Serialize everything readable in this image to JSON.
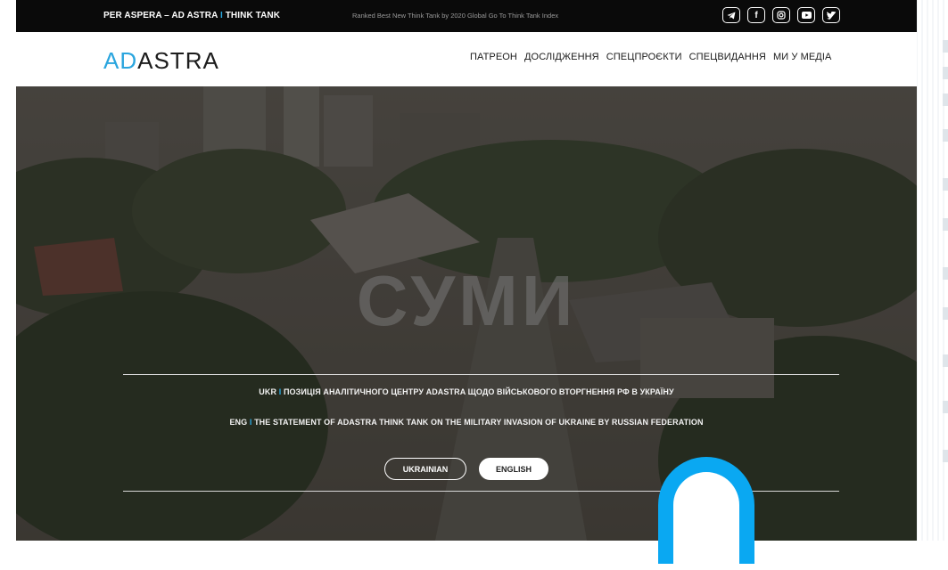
{
  "topbar": {
    "brand_left": "PER ASPERA – AD ASTRA",
    "brand_sep": "I",
    "brand_right": "THINK TANK",
    "tagline": "Ranked Best New Think Tank by 2020 Global Go To Think Tank Index",
    "socials": [
      {
        "icon": "telegram-icon"
      },
      {
        "icon": "facebook-icon",
        "glyph": "f"
      },
      {
        "icon": "instagram-icon"
      },
      {
        "icon": "youtube-icon"
      },
      {
        "icon": "twitter-icon"
      }
    ]
  },
  "logo": {
    "part1": "AD",
    "part2": "ASTRA"
  },
  "nav": {
    "items": [
      "ПАТРЕОН",
      "ДОСЛІДЖЕННЯ",
      "СПЕЦПРОЄКТИ",
      "СПЕЦВИДАННЯ",
      "МИ У МЕДІА"
    ]
  },
  "hero": {
    "title": "СУМИ",
    "line_ukr_prefix": "UKR",
    "line_ukr_sep": "I",
    "line_ukr_text": "ПОЗИЦІЯ АНАЛІТИЧНОГО ЦЕНТРУ ADASTRA ЩОДО ВІЙСЬКОВОГО ВТОРГНЕННЯ РФ В УКРАЇНУ",
    "line_eng_prefix": "ENG",
    "line_eng_sep": "I",
    "line_eng_text": "THE STATEMENT OF ADASTRA THINK TANK ON THE MILITARY INVASION OF UKRAINE BY RUSSIAN FEDERATION",
    "btn_ukrainian": "UKRAINIAN",
    "btn_english": "ENGLISH"
  },
  "colors": {
    "accent": "#29a9e1",
    "topbar_bg": "#0a0a0a",
    "cursor_blue": "#0aa8f2"
  }
}
